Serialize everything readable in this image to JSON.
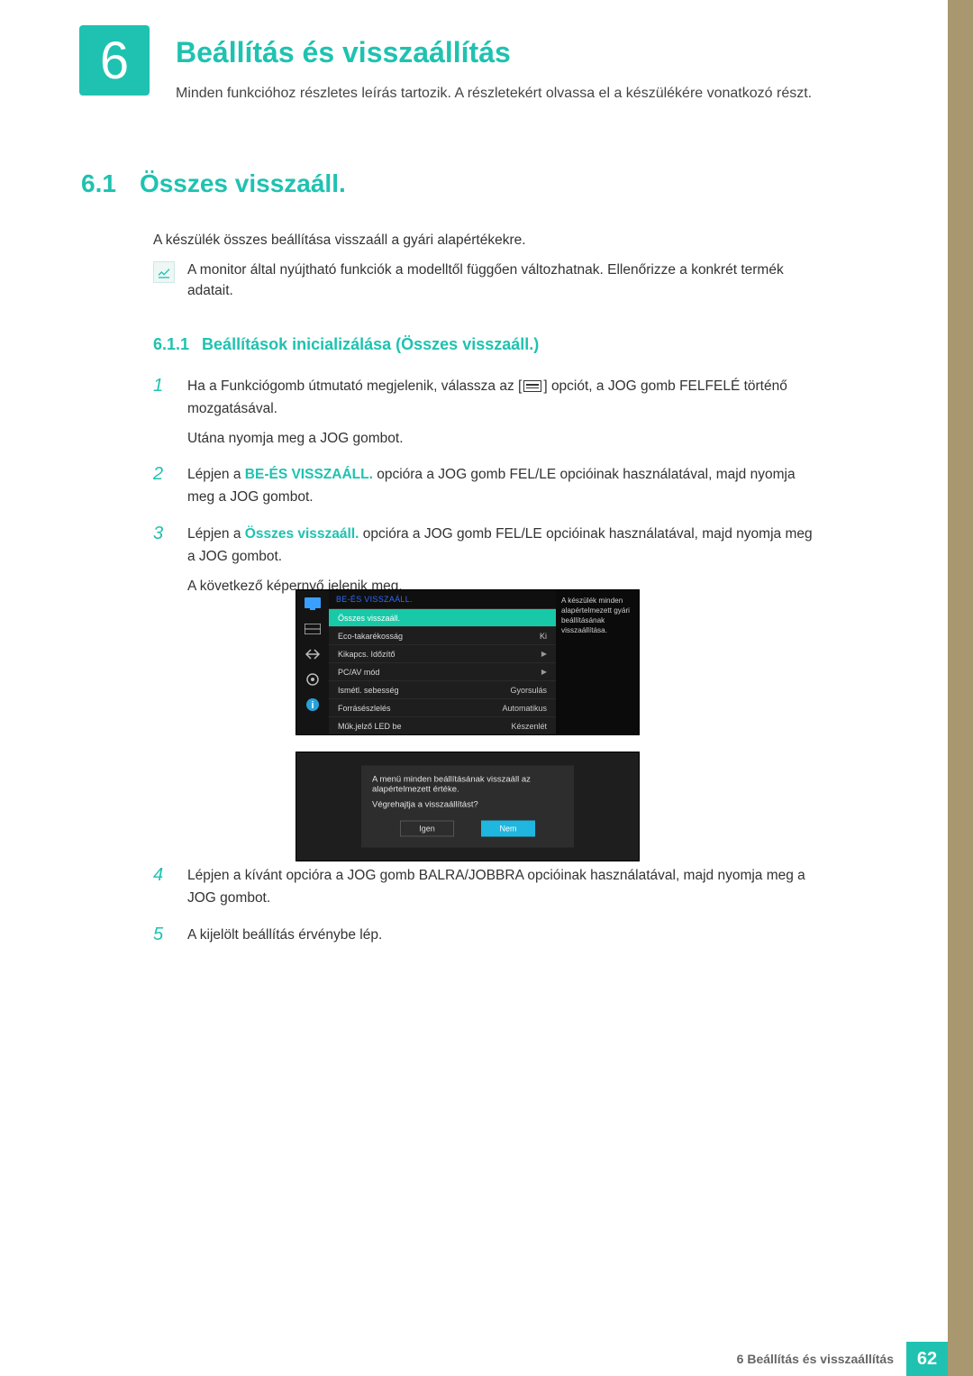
{
  "chapter": {
    "number": "6",
    "title": "Beállítás és visszaállítás",
    "intro": "Minden funkcióhoz részletes leírás tartozik. A részletekért olvassa el a készülékére vonatkozó részt."
  },
  "section": {
    "number": "6.1",
    "title": "Összes visszaáll.",
    "desc": "A készülék összes beállítása visszaáll a gyári alapértékekre.",
    "note": "A monitor által nyújtható funkciók a modelltől függően változhatnak. Ellenőrizze a konkrét termék adatait."
  },
  "subsection": {
    "number": "6.1.1",
    "title": "Beállítások inicializálása (Összes visszaáll.)"
  },
  "steps": {
    "s1a": "Ha a Funkciógomb útmutató megjelenik, válassza az [",
    "s1b": "] opciót, a JOG gomb FELFELÉ történő mozgatásával.",
    "s1c": "Utána nyomja meg a JOG gombot.",
    "s2a": "Lépjen a ",
    "s2hl": "BE-ÉS VISSZAÁLL.",
    "s2b": " opcióra a JOG gomb FEL/LE opcióinak használatával, majd nyomja meg a JOG gombot.",
    "s3a": "Lépjen a ",
    "s3hl": "Összes visszaáll.",
    "s3b": " opcióra a JOG gomb FEL/LE opcióinak használatával, majd nyomja meg a JOG gombot.",
    "s3c": "A következő képernyő jelenik meg.",
    "s4": "Lépjen a kívánt opcióra a JOG gomb BALRA/JOBBRA opcióinak használatával, majd nyomja meg a JOG gombot.",
    "s5": "A kijelölt beállítás érvénybe lép."
  },
  "step_nums": {
    "n1": "1",
    "n2": "2",
    "n3": "3",
    "n4": "4",
    "n5": "5"
  },
  "osd": {
    "header": "BE-ÉS VISSZAÁLL.",
    "rows": [
      {
        "label": "Összes visszaáll.",
        "value": ""
      },
      {
        "label": "Eco-takarékosság",
        "value": "Ki"
      },
      {
        "label": "Kikapcs. Időzítő",
        "value": "▶"
      },
      {
        "label": "PC/AV mód",
        "value": "▶"
      },
      {
        "label": "Ismétl. sebesség",
        "value": "Gyorsulás"
      },
      {
        "label": "Forrásészlelés",
        "value": "Automatikus"
      },
      {
        "label": "Műk.jelző LED be",
        "value": "Készenlét"
      }
    ],
    "side_help": "A készülék minden alapértelmezett gyári beállításának visszaállítása.",
    "dialog": {
      "line1": "A menü minden beállításának visszaáll az alapértelmezett értéke.",
      "line2": "Végrehajtja a visszaállítást?",
      "yes": "Igen",
      "no": "Nem"
    }
  },
  "footer": {
    "label": "6 Beállítás és visszaállítás",
    "page": "62"
  }
}
